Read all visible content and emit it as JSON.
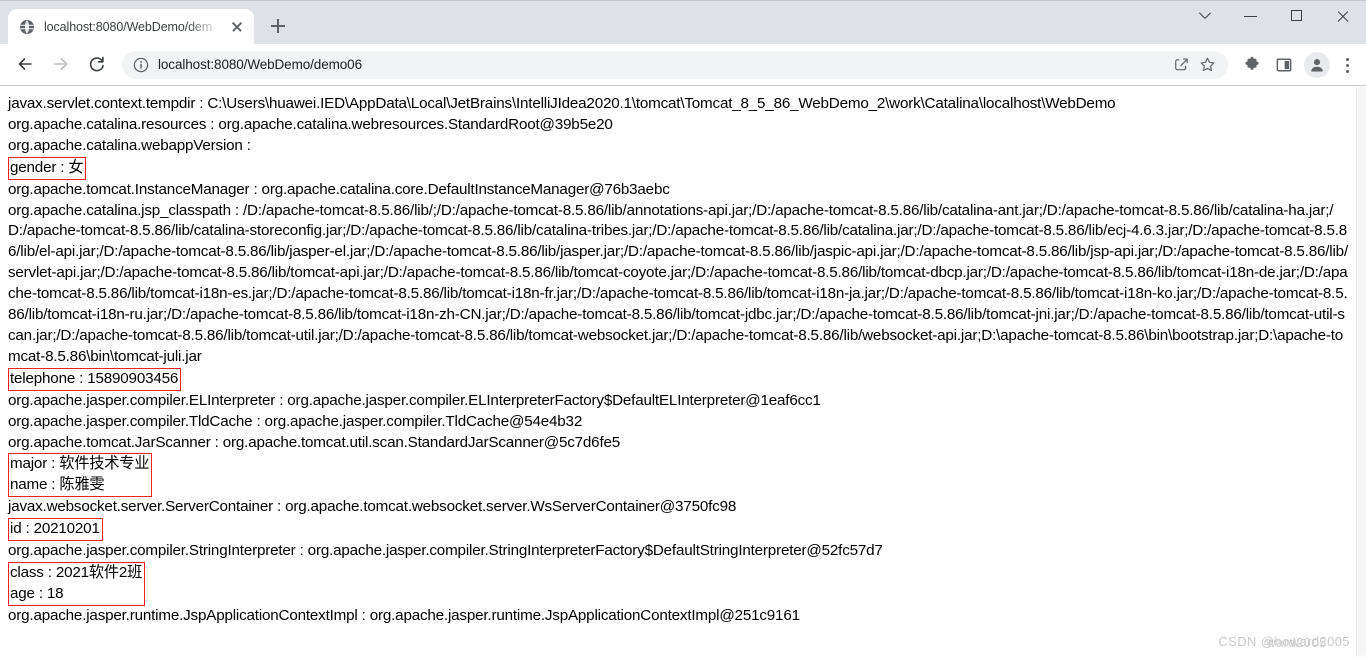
{
  "browser": {
    "tab": {
      "favicon": "globe-icon",
      "title": "localhost:8080/WebDemo/dem",
      "close_label": "close-tab"
    },
    "new_tab_label": "New tab",
    "window_controls": {
      "search_tabs": "search-tabs",
      "minimize": "minimize",
      "maximize": "maximize",
      "close": "close"
    },
    "toolbar": {
      "back": "back-icon",
      "forward": "forward-icon",
      "reload": "reload-icon",
      "site_info": "info-icon",
      "url": "localhost:8080/WebDemo/demo06",
      "share": "share-icon",
      "bookmark": "star-icon",
      "extensions": "puzzle-icon",
      "sidepanel": "sidepanel-icon",
      "profile": "profile-avatar-icon",
      "menu": "kebab-menu-icon"
    }
  },
  "page": {
    "lines": [
      {
        "id": "tempdir",
        "text": "javax.servlet.context.tempdir : C:\\Users\\huawei.IED\\AppData\\Local\\JetBrains\\IntelliJIdea2020.1\\tomcat\\Tomcat_8_5_86_WebDemo_2\\work\\Catalina\\localhost\\WebDemo",
        "boxed": false
      },
      {
        "id": "catalina-resources",
        "text": "org.apache.catalina.resources : org.apache.catalina.webresources.StandardRoot@39b5e20",
        "boxed": false
      },
      {
        "id": "webapp-version",
        "text": "org.apache.catalina.webappVersion :",
        "boxed": false
      },
      {
        "id": "attr-gender",
        "text": "gender : 女",
        "boxed": true
      },
      {
        "id": "instance-manager",
        "text": "org.apache.tomcat.InstanceManager : org.apache.catalina.core.DefaultInstanceManager@76b3aebc",
        "boxed": false
      },
      {
        "id": "jsp-classpath",
        "text": "org.apache.catalina.jsp_classpath : /D:/apache-tomcat-8.5.86/lib/;/D:/apache-tomcat-8.5.86/lib/annotations-api.jar;/D:/apache-tomcat-8.5.86/lib/catalina-ant.jar;/D:/apache-tomcat-8.5.86/lib/catalina-ha.jar;/D:/apache-tomcat-8.5.86/lib/catalina-storeconfig.jar;/D:/apache-tomcat-8.5.86/lib/catalina-tribes.jar;/D:/apache-tomcat-8.5.86/lib/catalina.jar;/D:/apache-tomcat-8.5.86/lib/ecj-4.6.3.jar;/D:/apache-tomcat-8.5.86/lib/el-api.jar;/D:/apache-tomcat-8.5.86/lib/jasper-el.jar;/D:/apache-tomcat-8.5.86/lib/jasper.jar;/D:/apache-tomcat-8.5.86/lib/jaspic-api.jar;/D:/apache-tomcat-8.5.86/lib/jsp-api.jar;/D:/apache-tomcat-8.5.86/lib/servlet-api.jar;/D:/apache-tomcat-8.5.86/lib/tomcat-api.jar;/D:/apache-tomcat-8.5.86/lib/tomcat-coyote.jar;/D:/apache-tomcat-8.5.86/lib/tomcat-dbcp.jar;/D:/apache-tomcat-8.5.86/lib/tomcat-i18n-de.jar;/D:/apache-tomcat-8.5.86/lib/tomcat-i18n-es.jar;/D:/apache-tomcat-8.5.86/lib/tomcat-i18n-fr.jar;/D:/apache-tomcat-8.5.86/lib/tomcat-i18n-ja.jar;/D:/apache-tomcat-8.5.86/lib/tomcat-i18n-ko.jar;/D:/apache-tomcat-8.5.86/lib/tomcat-i18n-ru.jar;/D:/apache-tomcat-8.5.86/lib/tomcat-i18n-zh-CN.jar;/D:/apache-tomcat-8.5.86/lib/tomcat-jdbc.jar;/D:/apache-tomcat-8.5.86/lib/tomcat-jni.jar;/D:/apache-tomcat-8.5.86/lib/tomcat-util-scan.jar;/D:/apache-tomcat-8.5.86/lib/tomcat-util.jar;/D:/apache-tomcat-8.5.86/lib/tomcat-websocket.jar;/D:/apache-tomcat-8.5.86/lib/websocket-api.jar;D:\\apache-tomcat-8.5.86\\bin\\bootstrap.jar;D:\\apache-tomcat-8.5.86\\bin\\tomcat-juli.jar",
        "boxed": false
      },
      {
        "id": "attr-telephone",
        "text": "telephone : 15890903456",
        "boxed": true
      },
      {
        "id": "el-interpreter",
        "text": "org.apache.jasper.compiler.ELInterpreter : org.apache.jasper.compiler.ELInterpreterFactory$DefaultELInterpreter@1eaf6cc1",
        "boxed": false
      },
      {
        "id": "tld-cache",
        "text": "org.apache.jasper.compiler.TldCache : org.apache.jasper.compiler.TldCache@54e4b32",
        "boxed": false
      },
      {
        "id": "jar-scanner",
        "text": "org.apache.tomcat.JarScanner : org.apache.tomcat.util.scan.StandardJarScanner@5c7d6fe5",
        "boxed": false
      },
      {
        "id": "attr-major",
        "text": "major : 软件技术专业",
        "boxed": true,
        "group": "a"
      },
      {
        "id": "attr-name",
        "text": "name : 陈雅雯",
        "boxed": true,
        "group": "a"
      },
      {
        "id": "server-container",
        "text": "javax.websocket.server.ServerContainer : org.apache.tomcat.websocket.server.WsServerContainer@3750fc98",
        "boxed": false
      },
      {
        "id": "attr-id",
        "text": "id : 20210201",
        "boxed": true
      },
      {
        "id": "string-interpreter",
        "text": "org.apache.jasper.compiler.StringInterpreter : org.apache.jasper.compiler.StringInterpreterFactory$DefaultStringInterpreter@52fc57d7",
        "boxed": false
      },
      {
        "id": "attr-class",
        "text": "class : 2021软件2班",
        "boxed": true,
        "group": "b"
      },
      {
        "id": "attr-age",
        "text": "age : 18",
        "boxed": true,
        "group": "b"
      },
      {
        "id": "jsp-app-context",
        "text": "org.apache.jasper.runtime.JspApplicationContextImpl : org.apache.jasper.runtime.JspApplicationContextImpl@251c9161",
        "boxed": false
      }
    ],
    "highlight_color": "#ef2020"
  },
  "watermark": {
    "text": "CSDN @howard2005",
    "duplicate": "ward2005"
  }
}
